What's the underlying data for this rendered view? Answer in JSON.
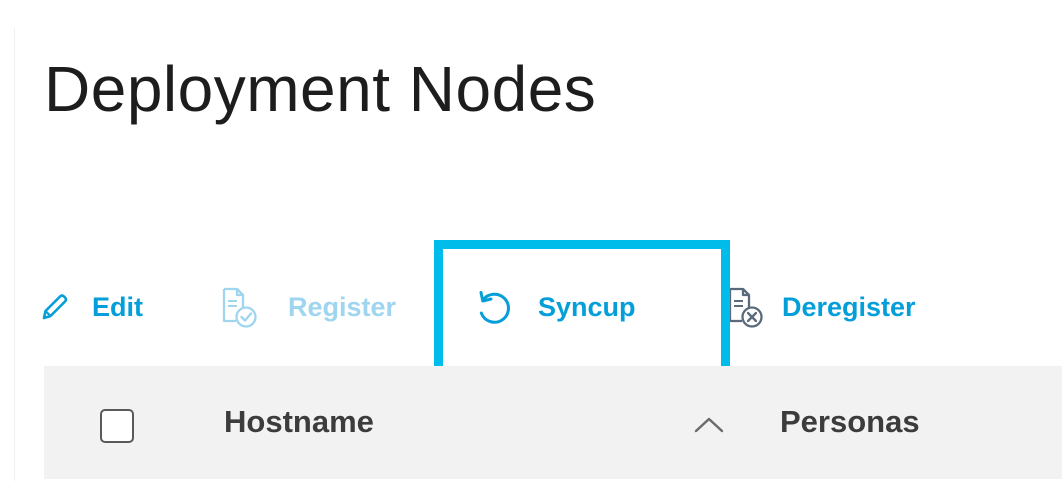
{
  "page": {
    "title": "Deployment Nodes"
  },
  "toolbar": {
    "edit_label": "Edit",
    "register_label": "Register",
    "syncup_label": "Syncup",
    "deregister_label": "Deregister"
  },
  "table": {
    "columns": [
      {
        "label": "Hostname",
        "sort": "ascending"
      },
      {
        "label": "Personas"
      }
    ]
  },
  "colors": {
    "action": "#049fd9",
    "action_disabled": "#9fd5ee",
    "highlight": "#00bceb",
    "header_bg": "#f2f2f2"
  },
  "icons": {
    "edit": "pencil-icon",
    "register": "document-check-icon",
    "syncup": "sync-icon",
    "deregister": "document-remove-icon",
    "sort": "chevron-up-icon"
  }
}
